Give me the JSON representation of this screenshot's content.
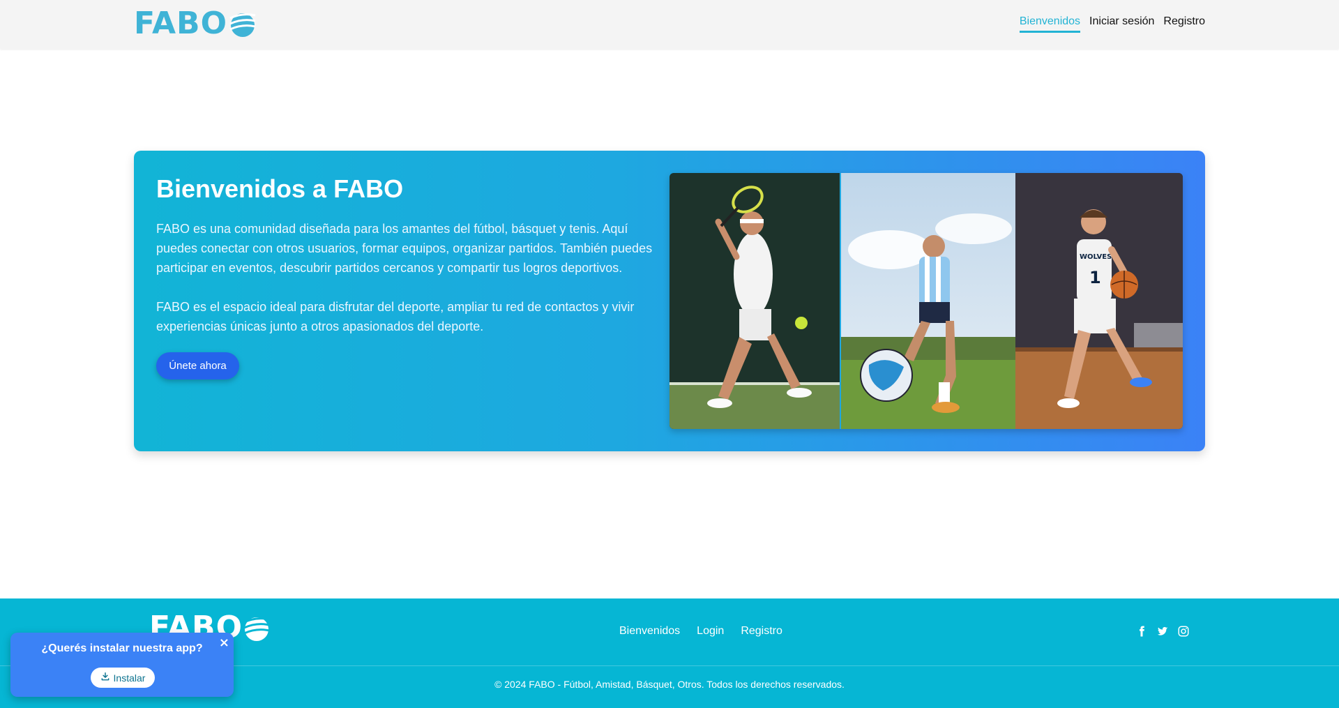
{
  "header": {
    "logo": "FABO",
    "nav": [
      {
        "label": "Bienvenidos",
        "active": true
      },
      {
        "label": "Iniciar sesión",
        "active": false
      },
      {
        "label": "Registro",
        "active": false
      }
    ]
  },
  "hero": {
    "title": "Bienvenidos a FABO",
    "paragraph1": "FABO es una comunidad diseñada para los amantes del fútbol, básquet y tenis. Aquí puedes conectar con otros usuarios, formar equipos, organizar partidos. También puedes participar en eventos, descubrir partidos cercanos y compartir tus logros deportivos.",
    "paragraph2": "FABO es el espacio ideal para disfrutar del deporte, ampliar tu red de contactos y vivir experiencias únicas junto a otros apasionados del deporte.",
    "cta_label": "Únete ahora",
    "photos": [
      "tennis-player",
      "soccer-player",
      "basketball-player"
    ],
    "jersey_text": "WOLVES",
    "jersey_number": "1"
  },
  "footer": {
    "logo": "FABO",
    "links": [
      "Bienvenidos",
      "Login",
      "Registro"
    ],
    "social_icons": [
      "facebook-icon",
      "twitter-icon",
      "instagram-icon"
    ],
    "copyright": "© 2024 FABO - Fútbol, Amistad, Básquet, Otros. Todos los derechos reservados."
  },
  "install_popup": {
    "title": "¿Querés instalar nuestra app?",
    "close_glyph": "×",
    "button_label": "Instalar"
  },
  "colors": {
    "brand": "#3fb3d6",
    "nav_active": "#22b3d4",
    "cta": "#2563eb",
    "footer": "#06b6d4",
    "popup": "#3b82f6"
  }
}
